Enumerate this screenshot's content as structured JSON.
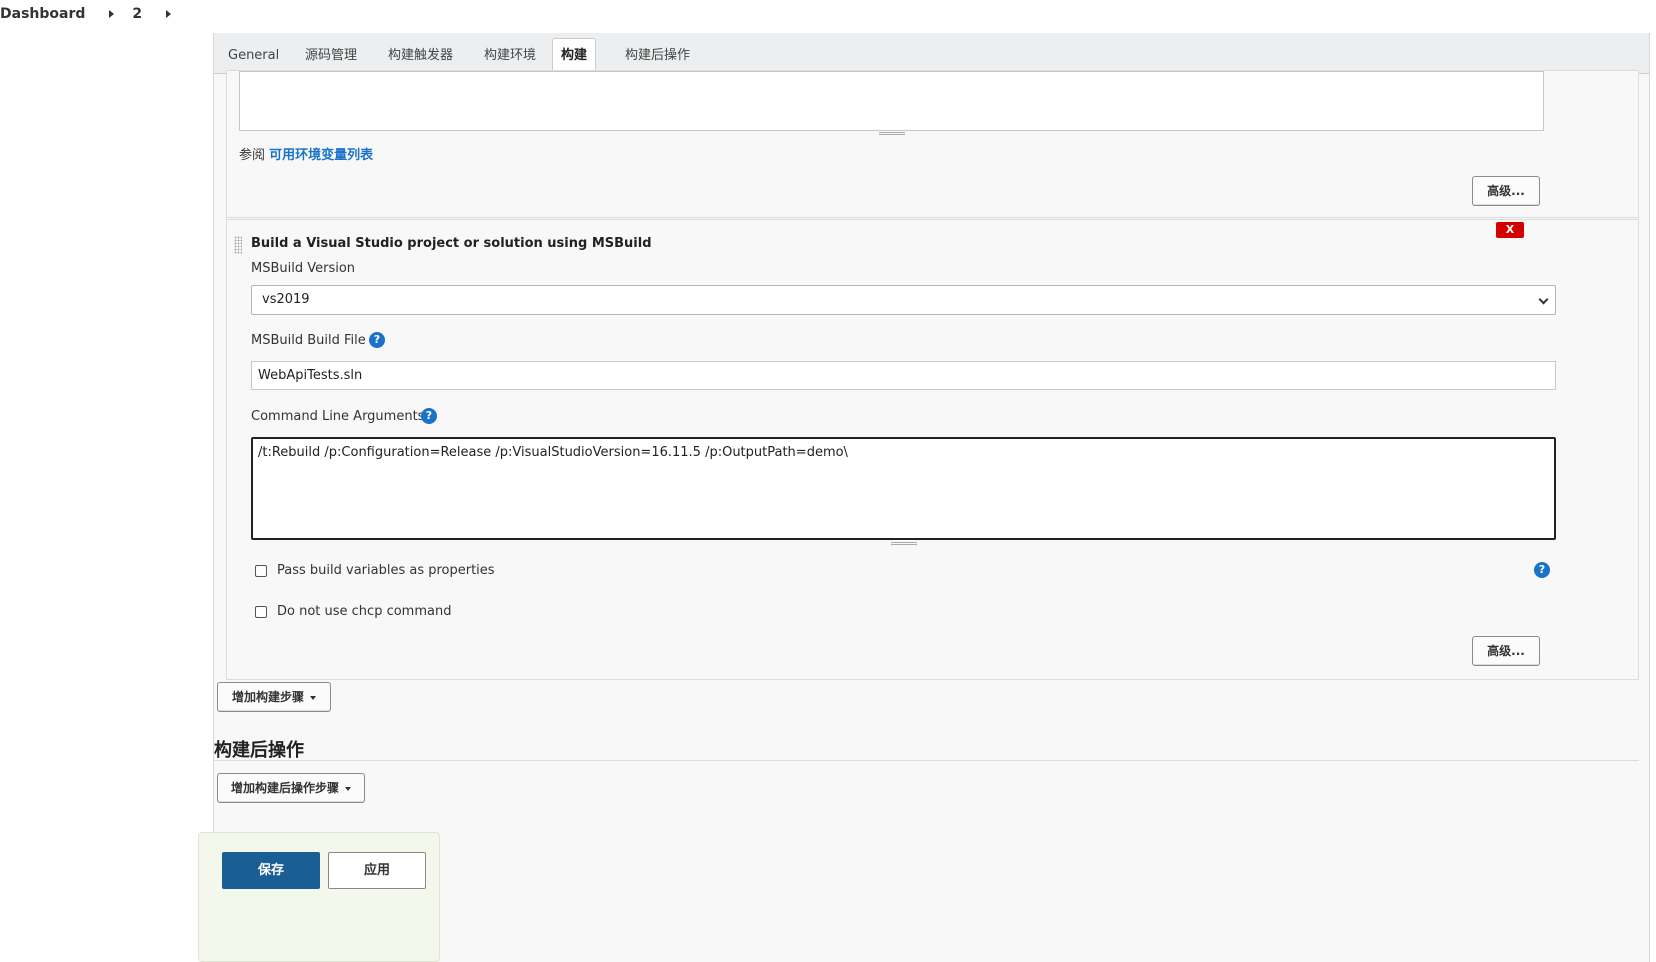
{
  "breadcrumb": {
    "items": [
      "Dashboard",
      "2"
    ]
  },
  "tabs": [
    "General",
    "源码管理",
    "构建触发器",
    "构建环境",
    "构建",
    "构建后操作"
  ],
  "active_tab": "构建",
  "env_section": {
    "see_prefix": "参阅",
    "env_link": "可用环境变量列表",
    "advanced_label": "高级..."
  },
  "msbuild": {
    "title": "Build a Visual Studio project or solution using MSBuild",
    "close_label": "X",
    "version_label": "MSBuild Version",
    "version_value": "vs2019",
    "build_file_label": "MSBuild Build File",
    "build_file_value": "WebApiTests.sln",
    "cmd_args_label": "Command Line Arguments",
    "cmd_args_value": "/t:Rebuild /p:Configuration=Release /p:VisualStudioVersion=16.11.5 /p:OutputPath=demo\\",
    "pass_vars_label": "Pass build variables as properties",
    "no_chcp_label": "Do not use chcp command",
    "advanced_label": "高级...",
    "help_glyph": "?"
  },
  "add_build_step_label": "增加构建步骤",
  "post_build": {
    "title": "构建后操作",
    "add_label": "增加构建后操作步骤"
  },
  "actions": {
    "save_label": "保存",
    "apply_label": "应用"
  },
  "colors": {
    "accent": "#1a73c8",
    "save_bg": "#1a5e96",
    "close_bg": "#d40000"
  }
}
